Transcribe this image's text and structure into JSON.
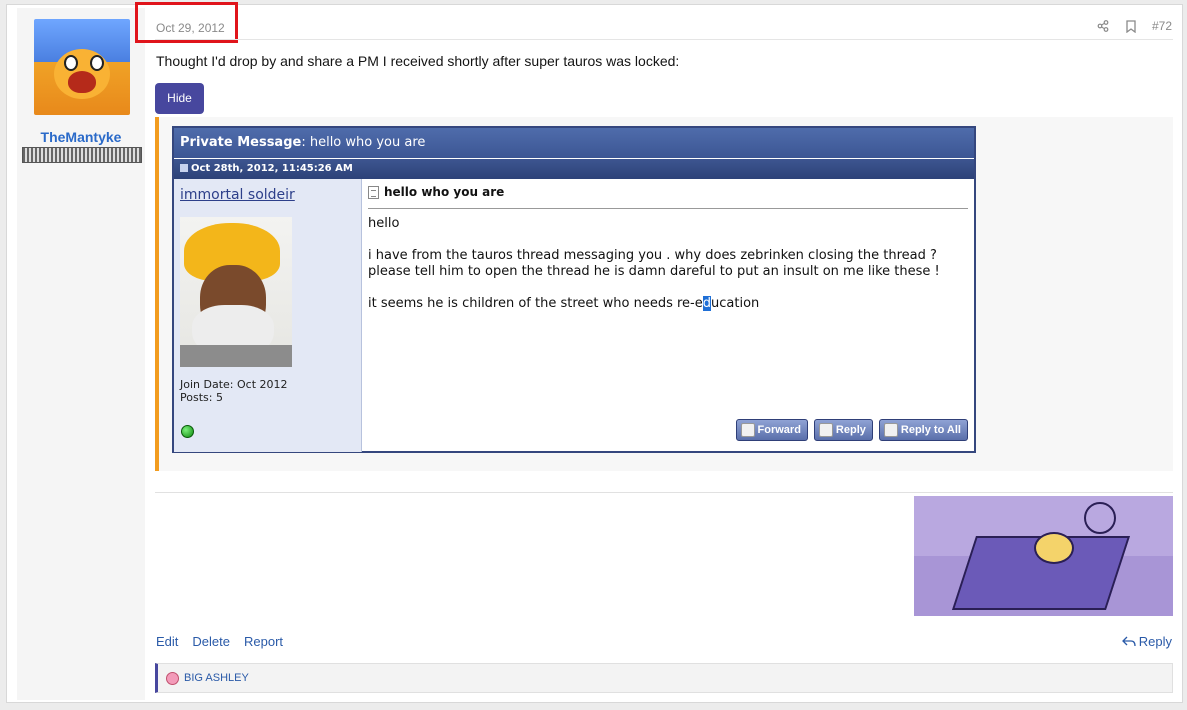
{
  "post": {
    "date": "Oct 29, 2012",
    "number": "#72",
    "text": "Thought I'd drop by and share a PM I received shortly after super tauros was locked:",
    "hide_label": "Hide"
  },
  "user": {
    "name": "TheMantyke"
  },
  "pm": {
    "title_label": "Private Message",
    "title_sep": ": ",
    "title_subject": "hello who you are",
    "date": "Oct 28th, 2012, 11:45:26 AM",
    "sender": "immortal soldeir",
    "join_date": "Join Date: Oct 2012",
    "posts": "Posts: 5",
    "subject": "hello who you are",
    "body": {
      "p1": "hello",
      "p2": "i have from the tauros thread messaging you . why does zebrinken closing the thread ?",
      "p3": "please tell him to open the thread he is damn dareful to put an insult on me like these !",
      "p4_before": "it seems he is children of the street who needs re-e",
      "p4_selected": "d",
      "p4_after": "ucation"
    },
    "buttons": {
      "forward": "Forward",
      "reply": "Reply",
      "reply_all": "Reply to All"
    }
  },
  "footer": {
    "edit": "Edit",
    "delete": "Delete",
    "report": "Report",
    "reply": "Reply"
  },
  "reactions": {
    "text": "BIG ASHLEY"
  },
  "colors": {
    "highlight": "#e0141b",
    "button": "#47479e",
    "spoiler_accent": "#f29c1f",
    "pm_header": "#3c5694",
    "link": "#2a5aa8"
  },
  "icons": [
    "share-icon",
    "bookmark-icon",
    "doc-icon",
    "online-status-icon",
    "reply-arrow-icon",
    "reaction-face-icon"
  ]
}
